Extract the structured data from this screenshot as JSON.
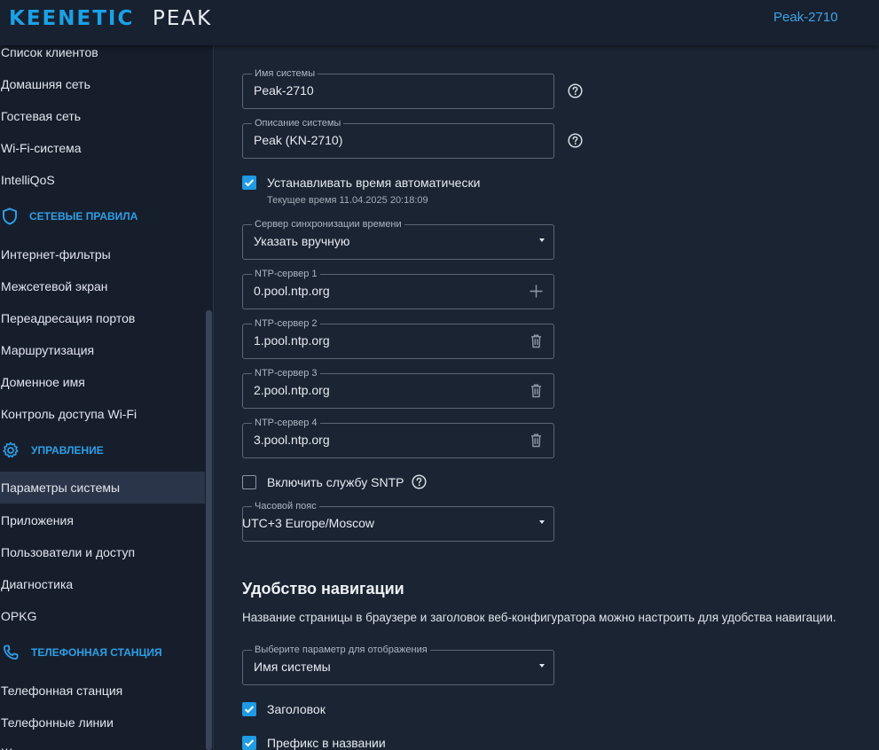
{
  "header": {
    "brand_primary": "KEENETIC",
    "brand_secondary": "PEAK",
    "device_name": "Peak-2710"
  },
  "sidebar": {
    "items_group1": [
      "Список клиентов",
      "Домашняя сеть",
      "Гостевая сеть",
      "Wi-Fi-система",
      "IntelliQoS"
    ],
    "section_network_rules": "СЕТЕВЫЕ ПРАВИЛА",
    "items_group2": [
      "Интернет-фильтры",
      "Межсетевой экран",
      "Переадресация портов",
      "Маршрутизация",
      "Доменное имя",
      "Контроль доступа Wi-Fi"
    ],
    "section_management": "УПРАВЛЕНИЕ",
    "items_group3": [
      "Параметры системы",
      "Приложения",
      "Пользователи и доступ",
      "Диагностика",
      "OPKG"
    ],
    "active_item": "Параметры системы",
    "section_telephony": "ТЕЛЕФОННАЯ СТАНЦИЯ",
    "items_group4": [
      "Телефонная станция",
      "Телефонные линии"
    ]
  },
  "main": {
    "system_name": {
      "label": "Имя системы",
      "value": "Peak-2710"
    },
    "system_description": {
      "label": "Описание системы",
      "value": "Peak (KN-2710)"
    },
    "auto_time": {
      "label": "Устанавливать время автоматически",
      "checked": true,
      "current_time": "Текущее время 11.04.2025 20:18:09"
    },
    "time_server": {
      "label": "Сервер синхронизации времени",
      "value": "Указать вручную"
    },
    "ntp_servers": [
      {
        "label": "NTP-сервер 1",
        "value": "0.pool.ntp.org",
        "icon": "plus-icon"
      },
      {
        "label": "NTP-сервер 2",
        "value": "1.pool.ntp.org",
        "icon": "trash-icon"
      },
      {
        "label": "NTP-сервер 3",
        "value": "2.pool.ntp.org",
        "icon": "trash-icon"
      },
      {
        "label": "NTP-сервер 4",
        "value": "3.pool.ntp.org",
        "icon": "trash-icon"
      }
    ],
    "sntp": {
      "label": "Включить службу SNTP",
      "checked": false
    },
    "timezone": {
      "label": "Часовой пояс",
      "value": "UTC+3 Europe/Moscow"
    },
    "nav_section": {
      "title": "Удобство навигации",
      "description": "Название страницы в браузере и заголовок веб-конфигуратора можно настроить для удобства навигации.",
      "display_param": {
        "label": "Выберите параметр для отображения",
        "value": "Имя системы"
      },
      "heading_checkbox": {
        "label": "Заголовок",
        "checked": true
      },
      "prefix_checkbox": {
        "label": "Префикс в названии",
        "checked": true
      }
    }
  },
  "colors": {
    "accent": "#1e9be3",
    "background": "#1b2433",
    "sidebar": "#161e2c",
    "header": "#182130"
  }
}
